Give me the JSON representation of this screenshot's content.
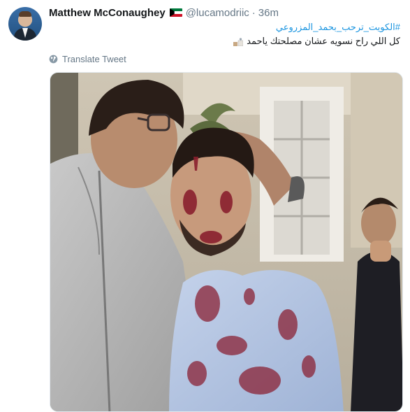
{
  "user": {
    "display_name": "Matthew McConaughey",
    "handle": "@lucamodriic",
    "separator": "·",
    "time": "36m",
    "flag_icon": "kuwait-flag-icon"
  },
  "tweet": {
    "hashtag": "#الكويت_ترحب_بحمد_المزروعي",
    "text": "كل اللي راح نسويه عشان مصلحتك ياحمد"
  },
  "translate": {
    "label": "Translate Tweet",
    "icon": "globe-icon"
  },
  "media": {
    "icon": "photo-image"
  },
  "colors": {
    "link": "#1b95e0",
    "secondary": "#657786",
    "text": "#14171a"
  }
}
